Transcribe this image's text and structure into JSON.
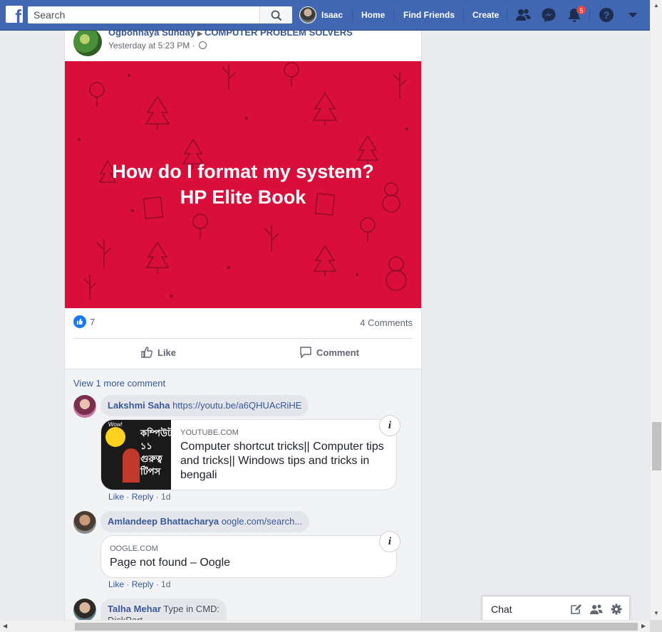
{
  "colors": {
    "brand": "#4267b2",
    "post_image_bg": "#d90e3b",
    "link": "#385898",
    "badge": "#fa3e3e"
  },
  "topbar": {
    "logo_icon": "facebook-f-logo",
    "search": {
      "placeholder": "Search",
      "value": ""
    },
    "profile_name": "Isaac",
    "nav": {
      "home": "Home",
      "find_friends": "Find Friends",
      "create": "Create"
    },
    "icons": [
      "friend-requests-icon",
      "messenger-icon",
      "notifications-icon",
      "help-icon",
      "account-menu-icon"
    ],
    "notification_count": "5"
  },
  "post": {
    "author": "Ogbonnaya Sunday",
    "group": "COMPUTER PROBLEM SOLVERS",
    "time": "Yesterday at 5:23 PM",
    "image_text_line1": "How do I format my system?",
    "image_text_line2": "HP Elite Book",
    "reaction_count": "7",
    "comments_count": "4 Comments",
    "like_label": "Like",
    "comment_label": "Comment"
  },
  "comments": {
    "view_more": "View 1 more comment",
    "items": [
      {
        "name": "Lakshmi Saha",
        "text": "https://youtu.be/a6QHUAcRiHE",
        "preview_domain": "YOUTUBE.COM",
        "preview_title": "Computer shortcut tricks|| Computer tips and tricks|| Windows tips and tricks in bengali",
        "thumb_badge": "Wow!",
        "thumb_text": "কম্পিউটা ১১ গুরুত্ব টিপস",
        "like": "Like",
        "reply": "Reply",
        "age": "1d"
      },
      {
        "name": "Amlandeep Bhattacharya",
        "text": "oogle.com/search...",
        "preview_domain": "OOGLE.COM",
        "preview_title": "Page not found – Oogle",
        "like": "Like",
        "reply": "Reply",
        "age": "1d"
      },
      {
        "name": "Talha Mehar",
        "text": "Type in CMD:",
        "text2": "DiskPart"
      }
    ]
  },
  "chat": {
    "label": "Chat"
  }
}
